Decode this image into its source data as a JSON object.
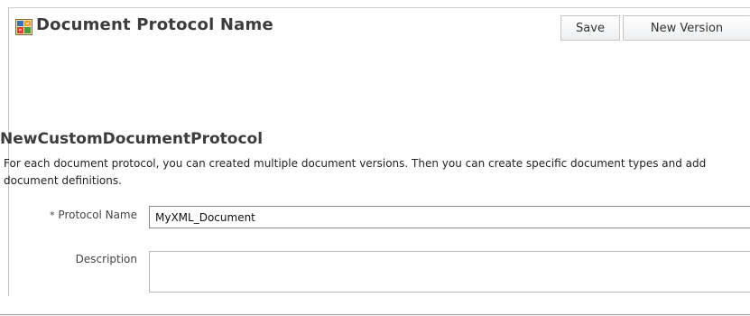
{
  "header": {
    "title": "Document Protocol Name",
    "icon": "document-protocol-icon",
    "save_label": "Save",
    "new_version_label": "New Version"
  },
  "section": {
    "title": "NewCustomDocumentProtocol",
    "description": "For each document protocol, you can created multiple document versions. Then you can create specific document types and add document definitions."
  },
  "form": {
    "protocol_name": {
      "required_mark": "*",
      "label": "Protocol Name",
      "value": "MyXML_Document"
    },
    "description": {
      "label": "Description",
      "value": ""
    }
  },
  "colors": {
    "title_text": "#3c3c3c",
    "button_border": "#c5c5c5",
    "input_border": "#8e8e8e"
  }
}
